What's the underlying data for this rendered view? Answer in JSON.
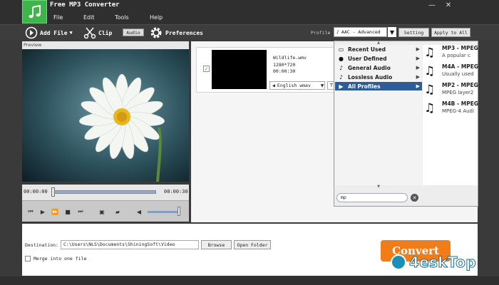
{
  "app": {
    "title": "Free MP3 Converter",
    "icon": "music-note-icon",
    "accent_color": "#3db54a"
  },
  "menu": [
    "File",
    "Edit",
    "Tools",
    "Help"
  ],
  "window_controls": {
    "minimize": "—",
    "close": "✕"
  },
  "toolbar": {
    "add_file_label": "Add File",
    "clip_label": "Clip",
    "audio_label": "Audio",
    "preferences_label": "Preferences",
    "profile_label": "Profile",
    "profile_value": "AAC - Advanced",
    "setting_label": "Setting",
    "apply_all_label": "Apply to All"
  },
  "preview": {
    "header": "Preview",
    "time_current": "00:00:00",
    "time_total": "00:00:30"
  },
  "file": {
    "name": "Wildlife.wmv",
    "resolution": "1280*720",
    "duration": "00:00:30",
    "audio_track": "English wmav",
    "checked": true
  },
  "profile_dropdown": {
    "categories": [
      {
        "label": "Recent Used",
        "icon": "document-icon",
        "selected": false
      },
      {
        "label": "User Defined",
        "icon": "user-icon",
        "selected": false
      },
      {
        "label": "General Audio",
        "icon": "music-note-icon",
        "selected": false
      },
      {
        "label": "Lossless Audio",
        "icon": "music-note-icon",
        "selected": false
      },
      {
        "label": "All Profiles",
        "icon": "play-icon",
        "selected": true
      }
    ],
    "formats": [
      {
        "name": "MP3 - MPEG",
        "desc": "A popular c",
        "highlighted": false
      },
      {
        "name": "M4A - MPEG",
        "desc": "Usually used",
        "highlighted": false
      },
      {
        "name": "MP2 - MPEG",
        "desc": "MPEG layer2",
        "highlighted": false
      },
      {
        "name": "M4B - MPEG",
        "desc": "MPEG-4 Audi",
        "highlighted": false
      }
    ],
    "search_value": "mp"
  },
  "output": {
    "destination_label": "Destination:",
    "destination_value": "C:\\Users\\NLS\\Documents\\ShiningSoft\\Video",
    "browse_label": "Browse",
    "open_folder_label": "Open Folder",
    "merge_label": "Merge into one file",
    "merge_checked": false,
    "convert_label": "Convert"
  },
  "watermark": {
    "text": "4eskTop"
  }
}
